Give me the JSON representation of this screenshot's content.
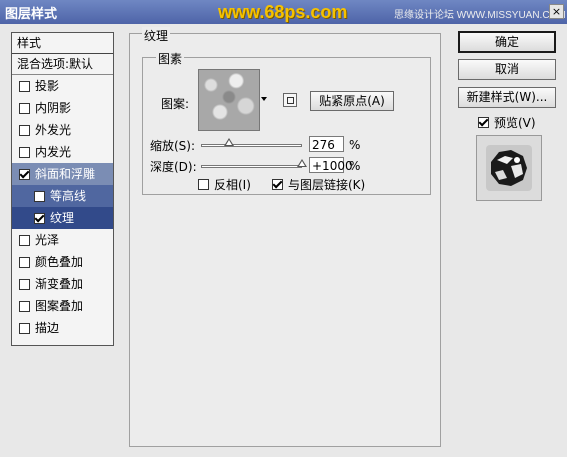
{
  "window": {
    "title": "图层样式",
    "close_glyph": "×"
  },
  "watermark": {
    "site": "www.68ps.com",
    "credit": "思缘设计论坛 WWW.MISSYUAN.COM"
  },
  "sidebar": {
    "header": "样式",
    "blend_options": "混合选项:默认",
    "items": [
      {
        "label": "投影",
        "checked": false
      },
      {
        "label": "内阴影",
        "checked": false
      },
      {
        "label": "外发光",
        "checked": false
      },
      {
        "label": "内发光",
        "checked": false
      },
      {
        "label": "斜面和浮雕",
        "checked": true
      },
      {
        "label": "等高线",
        "checked": false
      },
      {
        "label": "纹理",
        "checked": true
      },
      {
        "label": "光泽",
        "checked": false
      },
      {
        "label": "颜色叠加",
        "checked": false
      },
      {
        "label": "渐变叠加",
        "checked": false
      },
      {
        "label": "图案叠加",
        "checked": false
      },
      {
        "label": "描边",
        "checked": false
      }
    ]
  },
  "texture": {
    "group_title": "纹理",
    "subgroup_title": "图素",
    "pattern_label": "图案:",
    "snap_button": "贴紧原点(A)",
    "scale_label": "缩放(S):",
    "scale_value": "276",
    "scale_level_percent": 276,
    "depth_label": "深度(D):",
    "depth_value": "+1000",
    "depth_level_percent": 1000,
    "percent_sign": "%",
    "invert_label": "反相(I)",
    "invert_checked": false,
    "link_label": "与图层链接(K)",
    "link_checked": true
  },
  "buttons": {
    "ok": "确定",
    "cancel": "取消",
    "new_style": "新建样式(W)..."
  },
  "preview": {
    "label": "预览(V)",
    "checked": true
  }
}
